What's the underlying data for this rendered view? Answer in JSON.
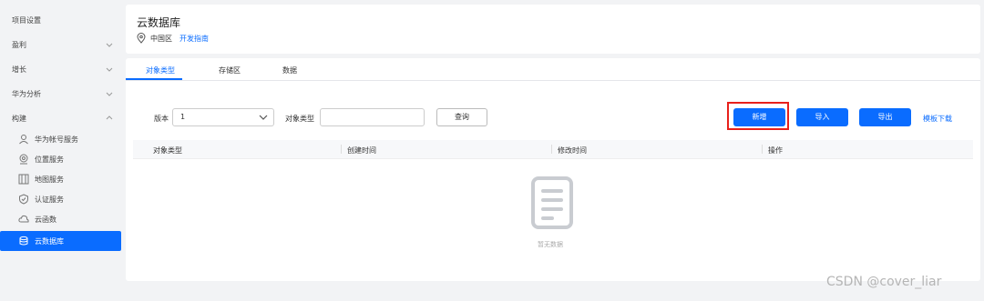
{
  "sidebar": {
    "items": [
      {
        "label": "项目设置"
      },
      {
        "label": "盈利"
      },
      {
        "label": "增长"
      },
      {
        "label": "华为分析"
      },
      {
        "label": "构建"
      }
    ],
    "sub_items": [
      {
        "label": "华为帐号服务",
        "icon": "user-icon"
      },
      {
        "label": "位置服务",
        "icon": "location-icon"
      },
      {
        "label": "地图服务",
        "icon": "map-icon"
      },
      {
        "label": "认证服务",
        "icon": "shield-icon"
      },
      {
        "label": "云函数",
        "icon": "cloud-function-icon"
      },
      {
        "label": "云数据库",
        "icon": "database-icon",
        "active": true
      }
    ]
  },
  "header": {
    "title": "云数据库",
    "region": "中国区",
    "guide_link": "开发指南"
  },
  "tabs": [
    {
      "label": "对象类型",
      "active": true
    },
    {
      "label": "存储区"
    },
    {
      "label": "数据"
    }
  ],
  "filters": {
    "version_label": "版本",
    "version_value": "1",
    "object_type_label": "对象类型",
    "object_type_placeholder": "",
    "query_button": "查询"
  },
  "actions": {
    "add_button": "新增",
    "import_button": "导入",
    "export_button": "导出",
    "template_download": "模板下载"
  },
  "table": {
    "columns": [
      "对象类型",
      "创建时间",
      "修改时间",
      "操作"
    ],
    "empty_text": "暂无数据"
  },
  "watermark": "CSDN @cover_liar",
  "colors": {
    "accent": "#0a6cff",
    "highlight": "#e8201b"
  }
}
